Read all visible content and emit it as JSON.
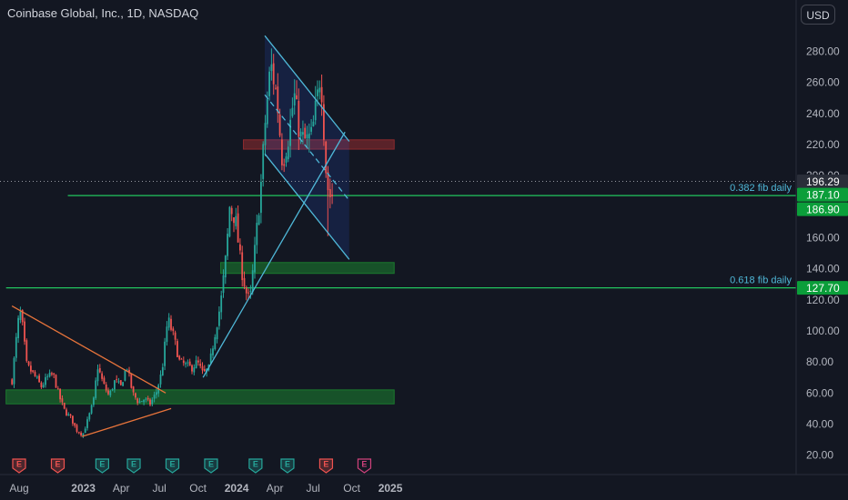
{
  "header": {
    "title": "Coinbase Global, Inc., 1D, NASDAQ",
    "currency_button": "USD"
  },
  "colors": {
    "background": "#131722",
    "candle_up": "#26a69a",
    "candle_down": "#ef5350",
    "support_zone": "#1b7a2e",
    "resistance_zone": "#8b2a2e",
    "channel": "#4fb8d8",
    "triangle": "#e8743b",
    "fib_line": "#22c55e",
    "fib_label": "#4fb8d8",
    "axis_text": "#b2b5be"
  },
  "chart_data": {
    "type": "candlestick",
    "title": "Coinbase Global, Inc., 1D, NASDAQ",
    "y_axis": {
      "position": "right",
      "ylim": [
        10,
        300
      ],
      "ticks": [
        20,
        40,
        60,
        80,
        100,
        120,
        140,
        160,
        180,
        200,
        220,
        240,
        260,
        280
      ],
      "tick_labels": [
        "20.00",
        "40.00",
        "60.00",
        "80.00",
        "100.00",
        "120.00",
        "140.00",
        "160.00",
        "180.00",
        "200.00",
        "220.00",
        "240.00",
        "260.00",
        "280.00"
      ]
    },
    "x_axis": {
      "ticks": [
        {
          "label": "Aug",
          "date": "2022-08-01"
        },
        {
          "label": "2023",
          "date": "2023-01-01"
        },
        {
          "label": "Apr",
          "date": "2023-04-01"
        },
        {
          "label": "Jul",
          "date": "2023-07-01"
        },
        {
          "label": "Oct",
          "date": "2023-10-01"
        },
        {
          "label": "2024",
          "date": "2024-01-01"
        },
        {
          "label": "Apr",
          "date": "2024-04-01"
        },
        {
          "label": "Jul",
          "date": "2024-07-01"
        },
        {
          "label": "Oct",
          "date": "2024-10-01"
        },
        {
          "label": "2025",
          "date": "2025-01-01"
        }
      ]
    },
    "price_path": [
      [
        "2022-07-15",
        68
      ],
      [
        "2022-07-29",
        105
      ],
      [
        "2022-08-05",
        112
      ],
      [
        "2022-08-19",
        78
      ],
      [
        "2022-09-09",
        70
      ],
      [
        "2022-09-23",
        64
      ],
      [
        "2022-10-07",
        70
      ],
      [
        "2022-10-21",
        72
      ],
      [
        "2022-11-04",
        58
      ],
      [
        "2022-11-18",
        48
      ],
      [
        "2022-12-02",
        44
      ],
      [
        "2022-12-16",
        36
      ],
      [
        "2022-12-30",
        33
      ],
      [
        "2023-01-13",
        44
      ],
      [
        "2023-01-27",
        57
      ],
      [
        "2023-02-03",
        78
      ],
      [
        "2023-02-17",
        66
      ],
      [
        "2023-03-03",
        58
      ],
      [
        "2023-03-17",
        68
      ],
      [
        "2023-03-31",
        64
      ],
      [
        "2023-04-14",
        78
      ],
      [
        "2023-04-28",
        60
      ],
      [
        "2023-05-12",
        54
      ],
      [
        "2023-05-26",
        56
      ],
      [
        "2023-06-09",
        53
      ],
      [
        "2023-06-23",
        60
      ],
      [
        "2023-07-07",
        74
      ],
      [
        "2023-07-21",
        108
      ],
      [
        "2023-08-04",
        96
      ],
      [
        "2023-08-18",
        80
      ],
      [
        "2023-09-01",
        78
      ],
      [
        "2023-09-15",
        76
      ],
      [
        "2023-09-29",
        80
      ],
      [
        "2023-10-13",
        72
      ],
      [
        "2023-10-27",
        76
      ],
      [
        "2023-11-10",
        98
      ],
      [
        "2023-11-24",
        118
      ],
      [
        "2023-12-08",
        152
      ],
      [
        "2023-12-15",
        180
      ],
      [
        "2023-12-29",
        172
      ],
      [
        "2024-01-12",
        140
      ],
      [
        "2024-01-26",
        122
      ],
      [
        "2024-02-02",
        120
      ],
      [
        "2024-02-16",
        160
      ],
      [
        "2024-02-29",
        198
      ],
      [
        "2024-03-08",
        232
      ],
      [
        "2024-03-22",
        272
      ],
      [
        "2024-04-05",
        252
      ],
      [
        "2024-04-19",
        208
      ],
      [
        "2024-05-03",
        225
      ],
      [
        "2024-05-17",
        252
      ],
      [
        "2024-05-31",
        225
      ],
      [
        "2024-06-14",
        222
      ],
      [
        "2024-06-28",
        226
      ],
      [
        "2024-07-12",
        252
      ],
      [
        "2024-07-19",
        268
      ],
      [
        "2024-08-02",
        196
      ],
      [
        "2024-08-09",
        186.9
      ],
      [
        "2024-08-16",
        187.1
      ]
    ],
    "horizontal_zones": [
      {
        "name": "resistance-zone",
        "from_date": "2024-01-17",
        "to_date": "2025-01-10",
        "low": 217,
        "high": 223,
        "color": "#8b2a2e"
      },
      {
        "name": "support-zone-mid",
        "from_date": "2023-11-24",
        "to_date": "2025-01-10",
        "low": 137,
        "high": 144,
        "color": "#1b7a2e"
      },
      {
        "name": "support-zone-low",
        "from_date": "2022-07-01",
        "to_date": "2025-01-10",
        "low": 53,
        "high": 62,
        "color": "#1b7a2e"
      }
    ],
    "fib_lines": [
      {
        "name": "0.382 fib daily",
        "value": 187.1,
        "from_date": "2022-11-25"
      },
      {
        "name": "0.618 fib daily",
        "value": 127.7,
        "from_date": "2022-07-01"
      }
    ],
    "price_labels": [
      {
        "value": 196.29,
        "text": "196.29",
        "color": "#2a2e39"
      },
      {
        "value": 187.1,
        "text": "187.10",
        "color": "#0b9e3a"
      },
      {
        "value": 186.9,
        "text": "186.90",
        "color": "#0b9e3a"
      },
      {
        "value": 127.7,
        "text": "127.70",
        "color": "#0b9e3a"
      }
    ],
    "trendlines": [
      {
        "name": "triangle-upper",
        "color": "#e8743b",
        "points": [
          [
            "2022-07-15",
            116
          ],
          [
            "2023-07-16",
            60
          ]
        ]
      },
      {
        "name": "triangle-lower",
        "color": "#e8743b",
        "points": [
          [
            "2022-12-29",
            32
          ],
          [
            "2023-07-29",
            50
          ]
        ]
      },
      {
        "name": "uptrend",
        "color": "#4fb8d8",
        "points": [
          [
            "2023-10-13",
            70
          ],
          [
            "2024-09-15",
            228
          ]
        ]
      },
      {
        "name": "channel-upper",
        "color": "#4fb8d8",
        "points": [
          [
            "2024-03-08",
            290
          ],
          [
            "2024-09-25",
            222
          ]
        ]
      },
      {
        "name": "channel-lower",
        "color": "#4fb8d8",
        "points": [
          [
            "2024-03-08",
            214
          ],
          [
            "2024-09-25",
            146
          ]
        ]
      },
      {
        "name": "channel-mid",
        "color": "#4fb8d8",
        "dashed": true,
        "points": [
          [
            "2024-03-08",
            252
          ],
          [
            "2024-09-25",
            184
          ]
        ]
      }
    ],
    "earnings_markers": [
      {
        "date": "2022-08-01",
        "label": "E",
        "type": "reported"
      },
      {
        "date": "2022-11-01",
        "label": "E",
        "type": "reported"
      },
      {
        "date": "2023-02-15",
        "label": "E",
        "type": "reported"
      },
      {
        "date": "2023-05-01",
        "label": "E",
        "type": "reported"
      },
      {
        "date": "2023-08-01",
        "label": "E",
        "type": "reported"
      },
      {
        "date": "2023-11-01",
        "label": "E",
        "type": "reported"
      },
      {
        "date": "2024-02-15",
        "label": "E",
        "type": "reported"
      },
      {
        "date": "2024-05-01",
        "label": "E",
        "type": "reported"
      },
      {
        "date": "2024-08-01",
        "label": "E",
        "type": "reported"
      },
      {
        "date": "2024-10-31",
        "label": "E",
        "type": "upcoming"
      }
    ]
  }
}
